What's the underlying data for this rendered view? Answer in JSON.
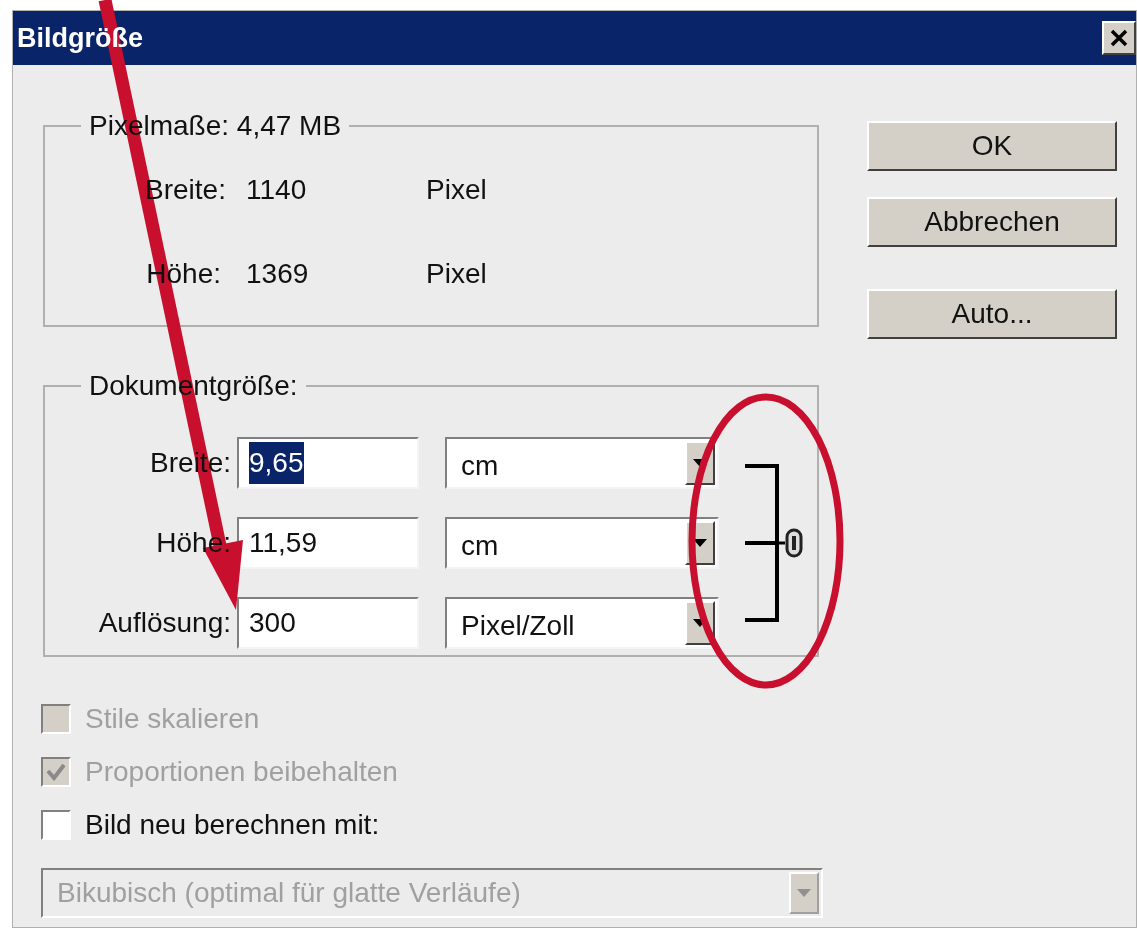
{
  "window": {
    "title": "Bildgröße"
  },
  "pixel_dimensions": {
    "legend": "Pixelmaße: 4,47 MB",
    "rows": [
      {
        "label": "Breite:",
        "value": "1140",
        "unit": "Pixel"
      },
      {
        "label": "Höhe:",
        "value": "1369",
        "unit": "Pixel"
      }
    ]
  },
  "document_size": {
    "legend": "Dokumentgröße:",
    "linked": true,
    "rows": [
      {
        "label": "Breite:",
        "value": "9,65",
        "selected": true,
        "unit": "cm"
      },
      {
        "label": "Höhe:",
        "value": "11,59",
        "selected": false,
        "unit": "cm"
      },
      {
        "label": "Auflösung:",
        "value": "300",
        "selected": false,
        "unit": "Pixel/Zoll"
      }
    ]
  },
  "buttons": [
    "OK",
    "Abbrechen",
    "Auto..."
  ],
  "options": [
    {
      "label": "Stile skalieren",
      "checked": false,
      "disabled": true
    },
    {
      "label": "Proportionen beibehalten",
      "checked": true,
      "disabled": true
    },
    {
      "label": "Bild neu berechnen mit:",
      "checked": false,
      "disabled": false
    }
  ],
  "resample": {
    "value": "Bikubisch (optimal für glatte Verläufe)",
    "disabled": true
  }
}
